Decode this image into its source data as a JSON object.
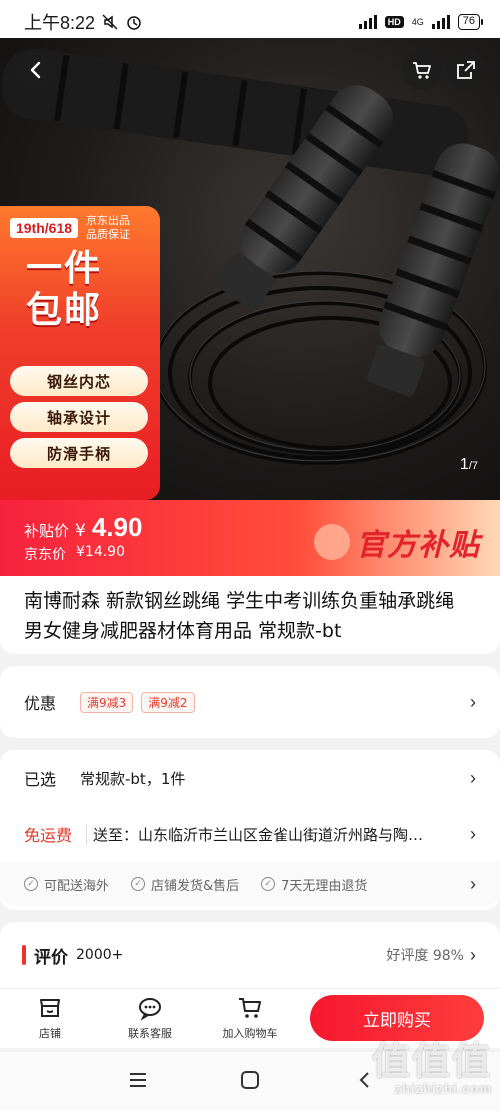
{
  "status": {
    "time": "上午8:22",
    "network": "4G",
    "battery": "76"
  },
  "hero": {
    "counter_current": "1",
    "counter_total": "/7",
    "promo": {
      "sale": "19th/618",
      "brand_line1": "京东出品",
      "brand_line2": "品质保证",
      "headline1": "一件",
      "headline2": "包邮",
      "features": [
        "钢丝内芯",
        "轴承设计",
        "防滑手柄"
      ]
    }
  },
  "price": {
    "subsidy_label": "补贴价",
    "currency": "¥",
    "subsidy_amount": "4.90",
    "jd_label": "京东价",
    "jd_price": "¥14.90",
    "badge": "官方补贴"
  },
  "product": {
    "title": "南博耐森 新款钢丝跳绳 学生中考训练负重轴承跳绳 男女健身减肥器材体育用品 常规款-bt"
  },
  "offers": {
    "label": "优惠",
    "coupons": [
      "满9减3",
      "满9减2"
    ]
  },
  "selection": {
    "label": "已选",
    "value": "常规款-bt，1件",
    "shipping_label": "免运费",
    "shipping_value": "送至：山东临沂市兰山区金雀山街道沂州路与陶…",
    "services": [
      "可配送海外",
      "店铺发货&售后",
      "7天无理由退货"
    ]
  },
  "reviews": {
    "label": "评价",
    "count": "2000+",
    "rating": "好评度 98%"
  },
  "actions": {
    "store": "店铺",
    "service": "联系客服",
    "cart": "加入购物车",
    "buy": "立即购买"
  },
  "watermark": {
    "main": "值值值",
    "sub": "zhizhizhi.com"
  },
  "colors": {
    "accent": "#f5182e",
    "price_bar": "#f7213d"
  }
}
